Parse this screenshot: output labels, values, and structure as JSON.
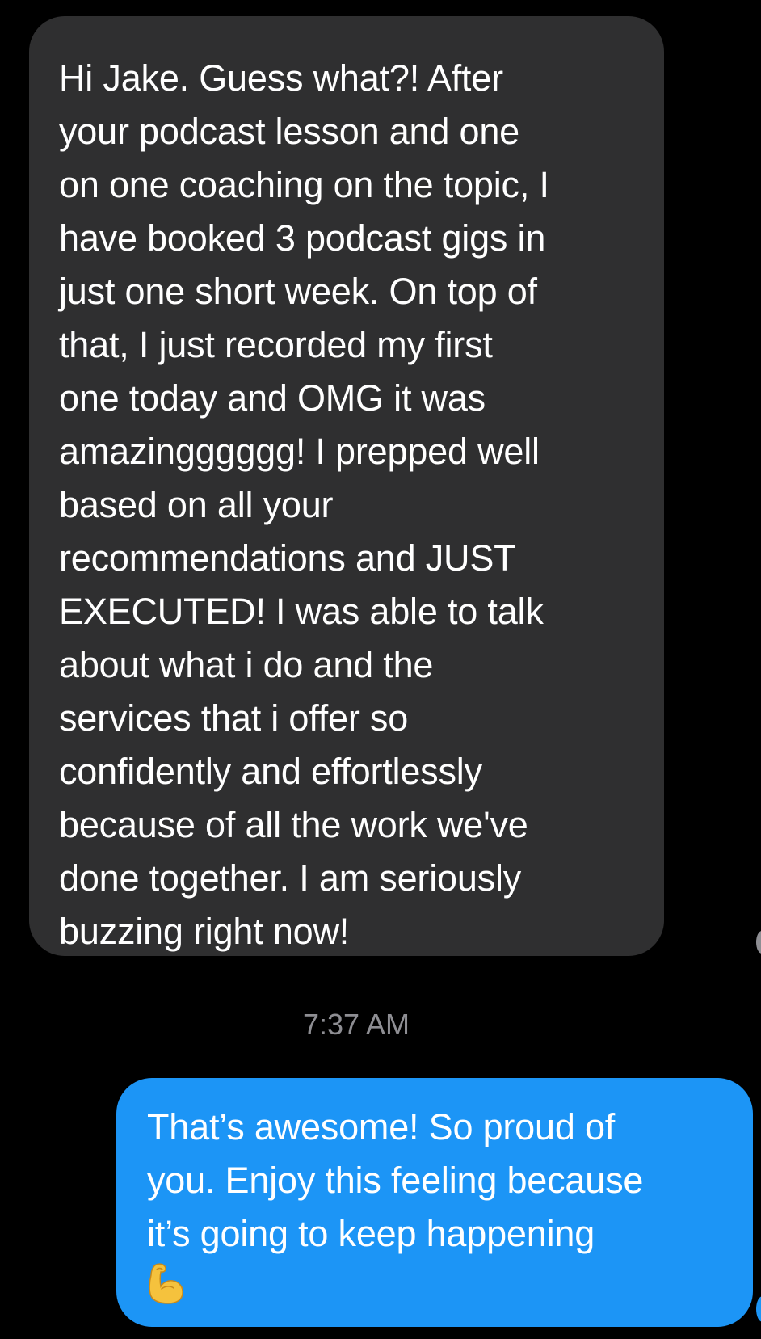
{
  "thread": {
    "received_message": {
      "lines": [
        "Hi Jake. Guess what?! After",
        "your podcast lesson and one",
        "on one coaching on the topic, I",
        "have booked 3 podcast gigs in",
        "just one short week. On top of",
        "that, I just recorded my first",
        "one today and OMG it was",
        "amazingggggg! I prepped well",
        "based on all your",
        "recommendations and JUST",
        "EXECUTED! I was able to talk",
        "about what i do and the",
        "services that i offer so",
        "confidently and effortlessly",
        "because of all the work we've",
        "done together. I am seriously",
        "buzzing right now!"
      ],
      "bubble_color": "#2f2f30"
    },
    "timestamp": "7:37 AM",
    "sent_message": {
      "lines": [
        "That’s awesome! So proud of",
        "you. Enjoy this feeling because",
        "it’s going to keep happening"
      ],
      "emoji": "flexed-biceps-icon",
      "bubble_color": "#1c95f6"
    }
  },
  "colors": {
    "background": "#000000",
    "text": "#ffffff",
    "timestamp": "#8e8e93"
  }
}
